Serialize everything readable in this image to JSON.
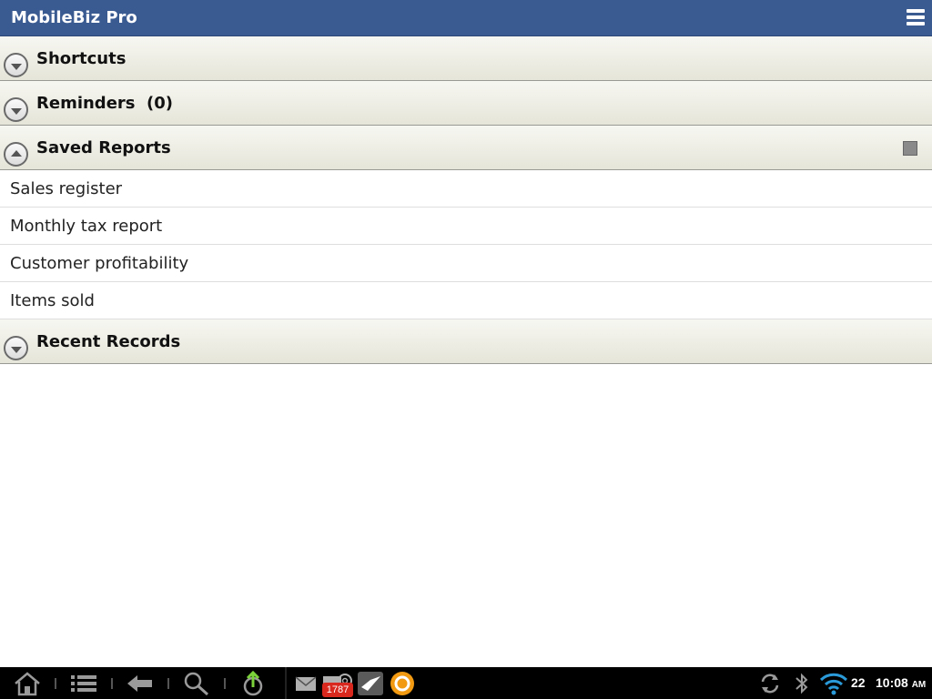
{
  "app": {
    "title": "MobileBiz Pro"
  },
  "sections": {
    "shortcuts": {
      "label": "Shortcuts"
    },
    "reminders": {
      "label": "Reminders  (0)"
    },
    "saved_reports": {
      "label": "Saved Reports",
      "items": [
        "Sales register",
        "Monthly tax report",
        "Customer profitability",
        "Items sold"
      ]
    },
    "recent_records": {
      "label": "Recent Records"
    }
  },
  "status_bar": {
    "mail_badge": "1787",
    "battery": "22",
    "time": "10:08",
    "ampm": "AM"
  },
  "colors": {
    "title_bar": "#3a5a92",
    "section_header": "#e6e5d9",
    "badge": "#d9281e"
  }
}
